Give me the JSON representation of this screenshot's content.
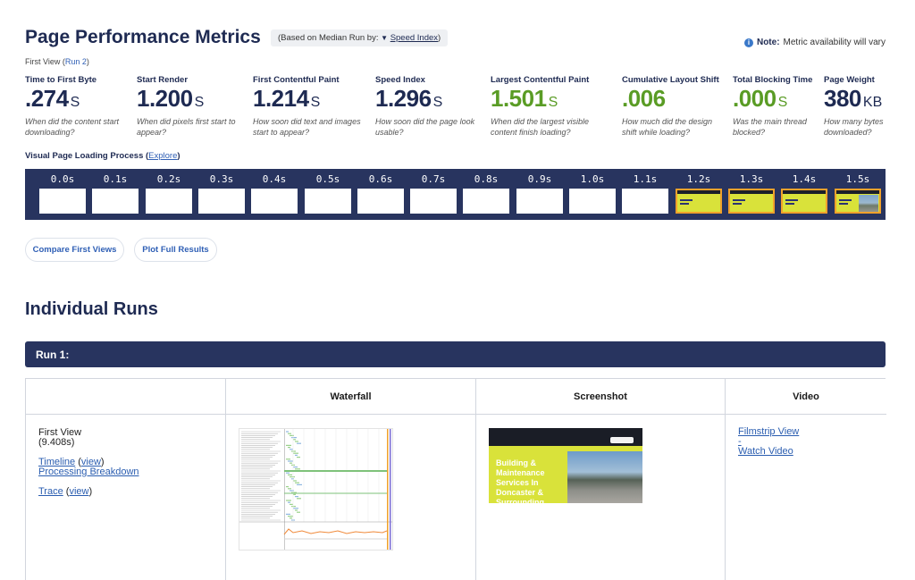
{
  "header": {
    "title": "Page Performance Metrics",
    "median_prefix": "(Based on Median Run by:",
    "median_arrow": "▼",
    "median_metric": "Speed Index",
    "median_suffix": ")",
    "note_label": "Note:",
    "note_text": "Metric availability will vary",
    "info_glyph": "i"
  },
  "view": {
    "label": "First View",
    "run_open": "(",
    "run_link": "Run 2",
    "run_close": ")"
  },
  "metrics": [
    {
      "label": "Time to First Byte",
      "value": ".274",
      "unit": "S",
      "desc": "When did the content start downloading?",
      "good": false
    },
    {
      "label": "Start Render",
      "value": "1.200",
      "unit": "S",
      "desc": "When did pixels first start to appear?",
      "good": false
    },
    {
      "label": "First Contentful Paint",
      "value": "1.214",
      "unit": "S",
      "desc": "How soon did text and images start to appear?",
      "good": false
    },
    {
      "label": "Speed Index",
      "value": "1.296",
      "unit": "S",
      "desc": "How soon did the page look usable?",
      "good": false
    },
    {
      "label": "Largest Contentful Paint",
      "value": "1.501",
      "unit": "S",
      "desc": "When did the largest visible content finish loading?",
      "good": true
    },
    {
      "label": "Cumulative Layout Shift",
      "value": ".006",
      "unit": "",
      "desc": "How much did the design shift while loading?",
      "good": true
    },
    {
      "label": "Total Blocking Time",
      "value": ".000",
      "unit": "S",
      "desc": "Was the main thread blocked?",
      "good": true
    },
    {
      "label": "Page Weight",
      "value": "380",
      "unit": "KB",
      "desc": "How many bytes downloaded?",
      "good": false
    }
  ],
  "visual": {
    "title": "Visual Page Loading Process",
    "explore_open": "(",
    "explore_link": "Explore",
    "explore_close": ")"
  },
  "filmstrip": [
    {
      "time": "0.0s",
      "state": "blank"
    },
    {
      "time": "0.1s",
      "state": "blank"
    },
    {
      "time": "0.2s",
      "state": "blank"
    },
    {
      "time": "0.3s",
      "state": "blank"
    },
    {
      "time": "0.4s",
      "state": "blank"
    },
    {
      "time": "0.5s",
      "state": "blank"
    },
    {
      "time": "0.6s",
      "state": "blank"
    },
    {
      "time": "0.7s",
      "state": "blank"
    },
    {
      "time": "0.8s",
      "state": "blank"
    },
    {
      "time": "0.9s",
      "state": "blank"
    },
    {
      "time": "1.0s",
      "state": "blank"
    },
    {
      "time": "1.1s",
      "state": "blank"
    },
    {
      "time": "1.2s",
      "state": "partial"
    },
    {
      "time": "1.3s",
      "state": "partial"
    },
    {
      "time": "1.4s",
      "state": "partial"
    },
    {
      "time": "1.5s",
      "state": "complete"
    }
  ],
  "buttons": {
    "compare": "Compare First Views",
    "plot": "Plot Full Results"
  },
  "runs": {
    "title": "Individual Runs",
    "run_label": "Run 1:",
    "columns": [
      "",
      "Waterfall",
      "Screenshot",
      "Video"
    ],
    "first_view": {
      "label": "First View",
      "duration": "(9.408s)",
      "timeline": "Timeline",
      "timeline_open": " (",
      "timeline_view": "view",
      "timeline_close": ")",
      "processing": "Processing Breakdown",
      "trace": "Trace",
      "trace_open": " (",
      "trace_view": "view",
      "trace_close": ")"
    },
    "screenshot_text": "Building & Maintenance Services In Doncaster & Surrounding",
    "video": {
      "filmstrip": "Filmstrip View",
      "sep": "-",
      "watch": "Watch Video"
    }
  },
  "colors": {
    "navy": "#28345f",
    "good_green": "#5a9c25",
    "link_blue": "#2f5fb5",
    "frame_change": "#f0a12b",
    "brand_yellow": "#d9e23a"
  }
}
